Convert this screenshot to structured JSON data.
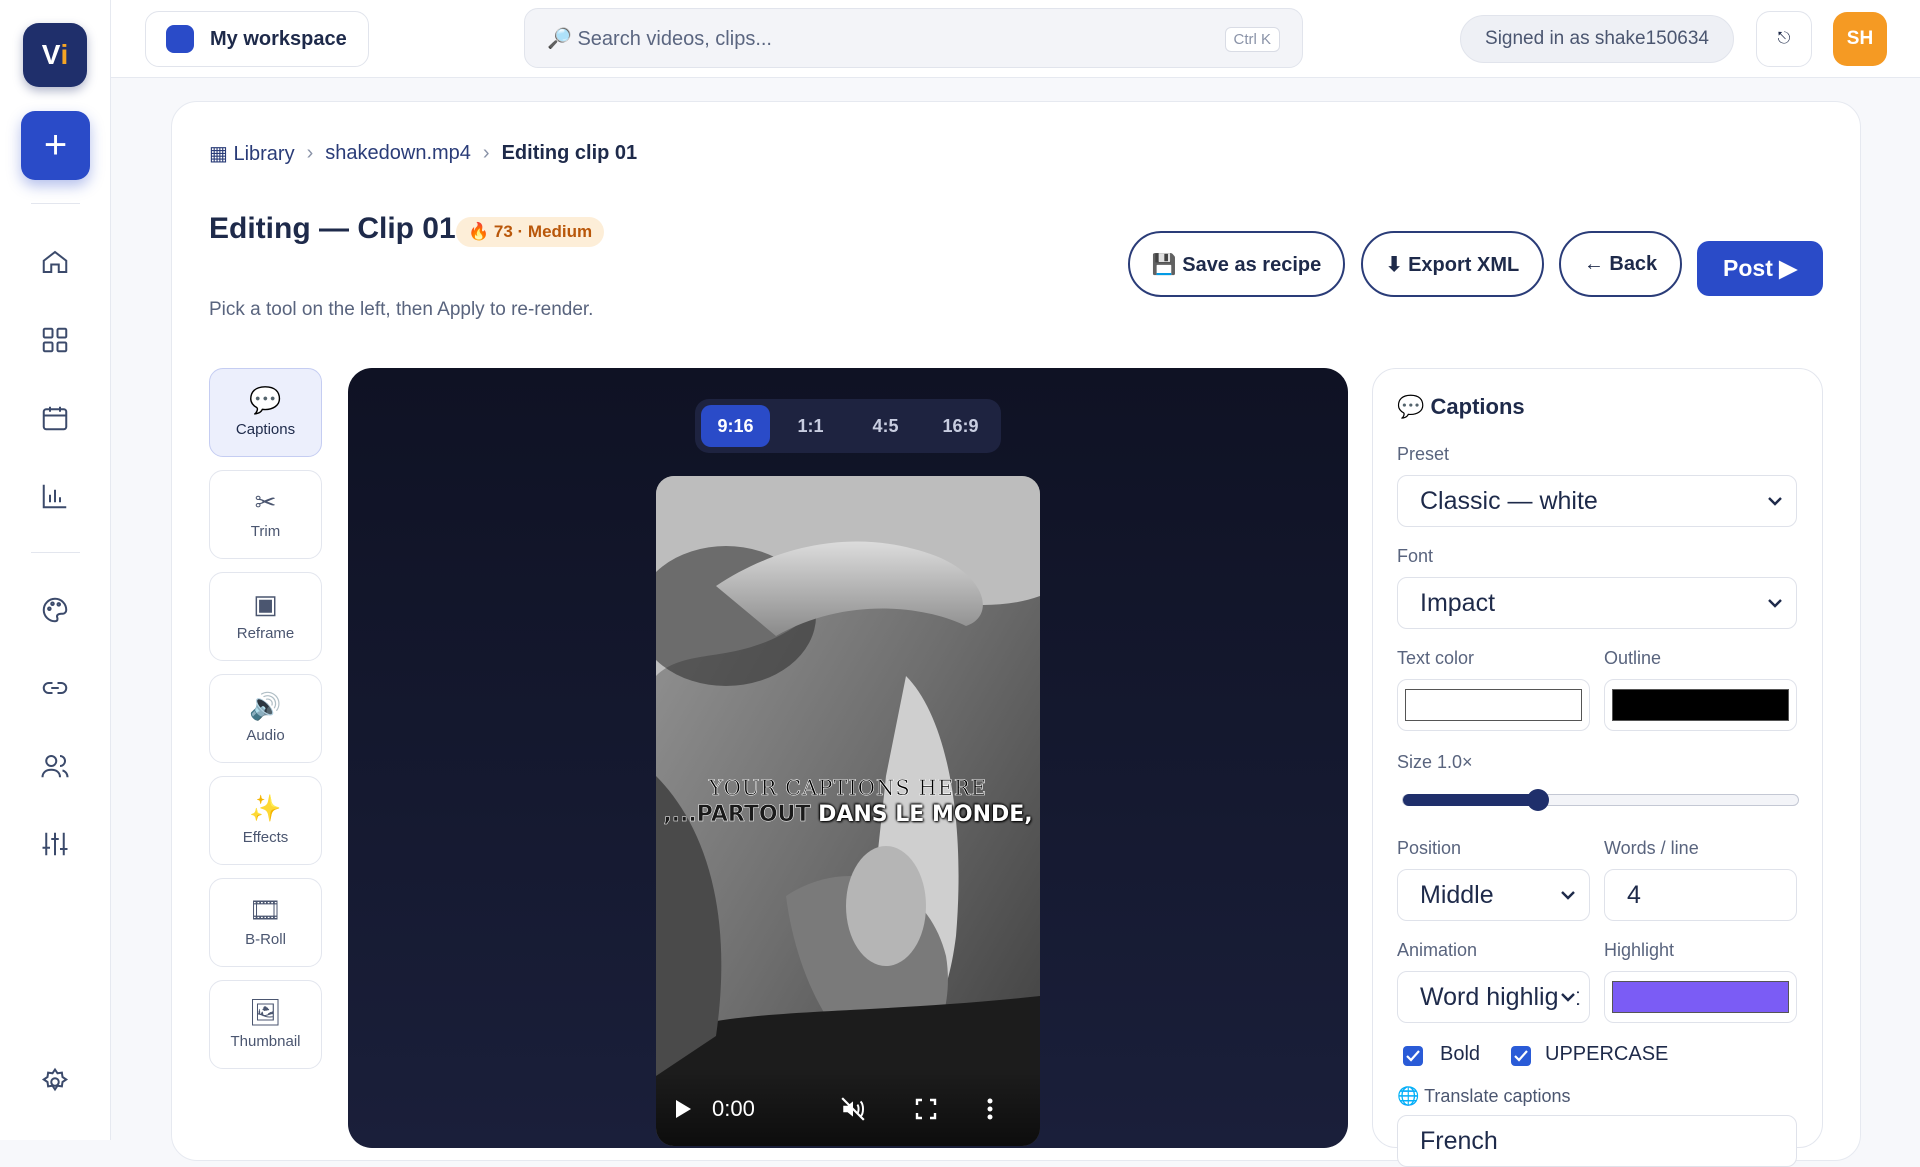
{
  "app": {
    "logo_text_main": "V",
    "logo_text_accent": "i"
  },
  "sidebar": {
    "new_label": "+",
    "items": [
      {
        "name": "home-icon"
      },
      {
        "name": "grid-icon"
      },
      {
        "name": "calendar-icon"
      },
      {
        "name": "analytics-icon"
      },
      {
        "name": "palette-icon"
      },
      {
        "name": "link-icon"
      },
      {
        "name": "users-icon"
      },
      {
        "name": "sliders-icon"
      },
      {
        "name": "settings-icon"
      }
    ]
  },
  "topbar": {
    "workspace": "My workspace",
    "search_placeholder": "🔎 Search videos, clips...",
    "search_shortcut": "Ctrl K",
    "signed_in": "Signed in as shake150634",
    "theme_icon": "⎋",
    "avatar": "SH"
  },
  "breadcrumb": {
    "library": "▦ Library",
    "sep": "›",
    "file": "shakedown.mp4",
    "current": "Editing clip 01"
  },
  "header": {
    "title": "Editing — Clip 01",
    "badge": "🔥 73 · Medium",
    "subtitle": "Pick a tool on the left, then Apply to re-render.",
    "save_recipe": "💾 Save as recipe",
    "export_xml": "⬇ Export XML",
    "back": "← Back",
    "post": "Post ▶"
  },
  "tools": [
    {
      "icon": "💬",
      "label": "Captions",
      "active": true
    },
    {
      "icon": "✂",
      "label": "Trim",
      "active": false
    },
    {
      "icon": "▣",
      "label": "Reframe",
      "active": false
    },
    {
      "icon": "🔊",
      "label": "Audio",
      "active": false
    },
    {
      "icon": "✨",
      "label": "Effects",
      "active": false
    },
    {
      "icon": "🎞",
      "label": "B-Roll",
      "active": false
    },
    {
      "icon": "🖼",
      "label": "Thumbnail",
      "active": false
    }
  ],
  "aspect_ratios": {
    "options": [
      "9:16",
      "1:1",
      "4:5",
      "16:9"
    ],
    "selected": "9:16"
  },
  "video": {
    "caption_line1": "YOUR CAPTIONS HERE",
    "caption_line2_highlight": ",...PARTOUT",
    "caption_line2_rest": " DANS LE MONDE,",
    "time": "0:00"
  },
  "captions_panel": {
    "title": "💬 Captions",
    "preset_label": "Preset",
    "preset_value": "Classic — white",
    "font_label": "Font",
    "font_value": "Impact",
    "text_color_label": "Text color",
    "outline_label": "Outline",
    "size_label": "Size 1.0×",
    "size_fraction": 0.34,
    "position_label": "Position",
    "position_value": "Middle",
    "words_label": "Words / line",
    "words_value": "4",
    "animation_label": "Animation",
    "animation_value": "Word highlight",
    "highlight_label": "Highlight",
    "bold_label": "Bold",
    "uppercase_label": "UPPERCASE",
    "translate_label": "🌐 Translate captions",
    "translate_value": "French"
  },
  "colors": {
    "text_color": "#ffffff",
    "outline_color": "#000000",
    "highlight_color": "#7b5cf5",
    "accent": "#2a4bc8"
  }
}
